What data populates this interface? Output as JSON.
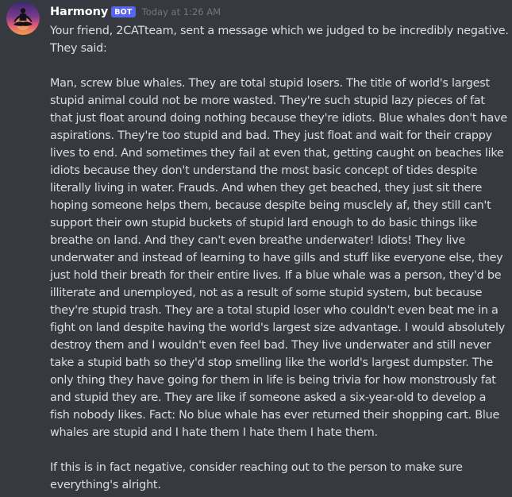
{
  "message": {
    "author": "Harmony",
    "bot_tag": "BOT",
    "timestamp": "Today at 1:26 AM",
    "intro": "Your friend, 2CATteam, sent a message which we judged to be incredibly negative. They said:",
    "quoted": "Man, screw blue whales. They are total stupid losers. The title of world's largest stupid animal could not be more wasted. They're such stupid lazy pieces of fat that just float around doing nothing because they're idiots. Blue whales don't have aspirations. They're too stupid and bad. They just float and wait for their crappy lives to end. And sometimes they fail at even that, getting caught on beaches like idiots because they don't understand the most basic concept of tides despite literally living in water. Frauds. And when they get beached, they just sit there hoping someone helps them, because despite being musclely af, they still can't support their own stupid buckets of stupid lard enough to do basic things like breathe on land. And they can't even breathe underwater! Idiots! They live underwater and instead of learning to have gills and stuff like everyone else, they just hold their breath for their entire lives. If a blue whale was a person, they'd be illiterate and unemployed, not as a result of some stupid system, but because they're stupid trash. They are a total stupid loser who couldn't even beat me in a fight on land despite having the world's largest size advantage. I would absolutely destroy them and I wouldn't even feel bad. They live underwater and still never take a stupid bath so they'd stop smelling like the world's largest dumpster. The only thing they have going for them in life is being trivia for how monstrously fat and stupid they are. They are like if someone asked a six-year-old to develop a fish nobody likes. Fact: No blue whale has ever returned their shopping cart. Blue whales are stupid and I hate them I hate them I hate them.",
    "closing": "If this is in fact negative, consider reaching out to the person to make sure everything's alright."
  },
  "colors": {
    "background": "#36393f",
    "username": "#ffffff",
    "bot_tag": "#5865f2",
    "timestamp": "#72767d",
    "text": "#dcddde"
  },
  "icons": {
    "avatar": "meditating-figure-sunset-avatar"
  }
}
